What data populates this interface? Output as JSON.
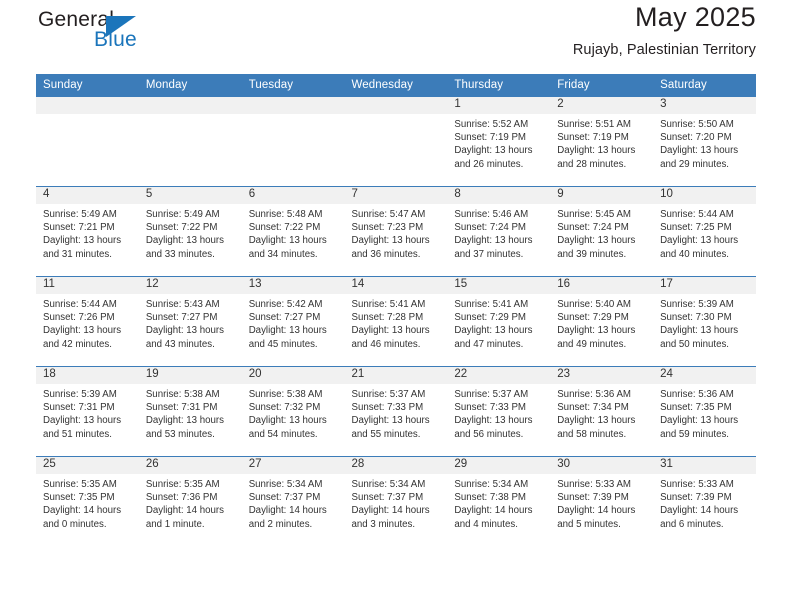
{
  "brand": {
    "name_top": "General",
    "name_bottom": "Blue",
    "accent_color": "#1b75bb"
  },
  "header": {
    "title": "May 2025",
    "subtitle": "Rujayb, Palestinian Territory"
  },
  "theme": {
    "header_row_bg": "#3c7cb9",
    "daynum_band_bg": "#f1f1f1",
    "text_color": "#333333"
  },
  "weekday_headers": [
    "Sunday",
    "Monday",
    "Tuesday",
    "Wednesday",
    "Thursday",
    "Friday",
    "Saturday"
  ],
  "calendar": {
    "weeks": [
      [
        {
          "day": "",
          "empty": true,
          "sunrise": "",
          "sunset": "",
          "daylight_line1": "",
          "daylight_line2": ""
        },
        {
          "day": "",
          "empty": true,
          "sunrise": "",
          "sunset": "",
          "daylight_line1": "",
          "daylight_line2": ""
        },
        {
          "day": "",
          "empty": true,
          "sunrise": "",
          "sunset": "",
          "daylight_line1": "",
          "daylight_line2": ""
        },
        {
          "day": "",
          "empty": true,
          "sunrise": "",
          "sunset": "",
          "daylight_line1": "",
          "daylight_line2": ""
        },
        {
          "day": "1",
          "empty": false,
          "sunrise": "Sunrise: 5:52 AM",
          "sunset": "Sunset: 7:19 PM",
          "daylight_line1": "Daylight: 13 hours",
          "daylight_line2": "and 26 minutes."
        },
        {
          "day": "2",
          "empty": false,
          "sunrise": "Sunrise: 5:51 AM",
          "sunset": "Sunset: 7:19 PM",
          "daylight_line1": "Daylight: 13 hours",
          "daylight_line2": "and 28 minutes."
        },
        {
          "day": "3",
          "empty": false,
          "sunrise": "Sunrise: 5:50 AM",
          "sunset": "Sunset: 7:20 PM",
          "daylight_line1": "Daylight: 13 hours",
          "daylight_line2": "and 29 minutes."
        }
      ],
      [
        {
          "day": "4",
          "empty": false,
          "sunrise": "Sunrise: 5:49 AM",
          "sunset": "Sunset: 7:21 PM",
          "daylight_line1": "Daylight: 13 hours",
          "daylight_line2": "and 31 minutes."
        },
        {
          "day": "5",
          "empty": false,
          "sunrise": "Sunrise: 5:49 AM",
          "sunset": "Sunset: 7:22 PM",
          "daylight_line1": "Daylight: 13 hours",
          "daylight_line2": "and 33 minutes."
        },
        {
          "day": "6",
          "empty": false,
          "sunrise": "Sunrise: 5:48 AM",
          "sunset": "Sunset: 7:22 PM",
          "daylight_line1": "Daylight: 13 hours",
          "daylight_line2": "and 34 minutes."
        },
        {
          "day": "7",
          "empty": false,
          "sunrise": "Sunrise: 5:47 AM",
          "sunset": "Sunset: 7:23 PM",
          "daylight_line1": "Daylight: 13 hours",
          "daylight_line2": "and 36 minutes."
        },
        {
          "day": "8",
          "empty": false,
          "sunrise": "Sunrise: 5:46 AM",
          "sunset": "Sunset: 7:24 PM",
          "daylight_line1": "Daylight: 13 hours",
          "daylight_line2": "and 37 minutes."
        },
        {
          "day": "9",
          "empty": false,
          "sunrise": "Sunrise: 5:45 AM",
          "sunset": "Sunset: 7:24 PM",
          "daylight_line1": "Daylight: 13 hours",
          "daylight_line2": "and 39 minutes."
        },
        {
          "day": "10",
          "empty": false,
          "sunrise": "Sunrise: 5:44 AM",
          "sunset": "Sunset: 7:25 PM",
          "daylight_line1": "Daylight: 13 hours",
          "daylight_line2": "and 40 minutes."
        }
      ],
      [
        {
          "day": "11",
          "empty": false,
          "sunrise": "Sunrise: 5:44 AM",
          "sunset": "Sunset: 7:26 PM",
          "daylight_line1": "Daylight: 13 hours",
          "daylight_line2": "and 42 minutes."
        },
        {
          "day": "12",
          "empty": false,
          "sunrise": "Sunrise: 5:43 AM",
          "sunset": "Sunset: 7:27 PM",
          "daylight_line1": "Daylight: 13 hours",
          "daylight_line2": "and 43 minutes."
        },
        {
          "day": "13",
          "empty": false,
          "sunrise": "Sunrise: 5:42 AM",
          "sunset": "Sunset: 7:27 PM",
          "daylight_line1": "Daylight: 13 hours",
          "daylight_line2": "and 45 minutes."
        },
        {
          "day": "14",
          "empty": false,
          "sunrise": "Sunrise: 5:41 AM",
          "sunset": "Sunset: 7:28 PM",
          "daylight_line1": "Daylight: 13 hours",
          "daylight_line2": "and 46 minutes."
        },
        {
          "day": "15",
          "empty": false,
          "sunrise": "Sunrise: 5:41 AM",
          "sunset": "Sunset: 7:29 PM",
          "daylight_line1": "Daylight: 13 hours",
          "daylight_line2": "and 47 minutes."
        },
        {
          "day": "16",
          "empty": false,
          "sunrise": "Sunrise: 5:40 AM",
          "sunset": "Sunset: 7:29 PM",
          "daylight_line1": "Daylight: 13 hours",
          "daylight_line2": "and 49 minutes."
        },
        {
          "day": "17",
          "empty": false,
          "sunrise": "Sunrise: 5:39 AM",
          "sunset": "Sunset: 7:30 PM",
          "daylight_line1": "Daylight: 13 hours",
          "daylight_line2": "and 50 minutes."
        }
      ],
      [
        {
          "day": "18",
          "empty": false,
          "sunrise": "Sunrise: 5:39 AM",
          "sunset": "Sunset: 7:31 PM",
          "daylight_line1": "Daylight: 13 hours",
          "daylight_line2": "and 51 minutes."
        },
        {
          "day": "19",
          "empty": false,
          "sunrise": "Sunrise: 5:38 AM",
          "sunset": "Sunset: 7:31 PM",
          "daylight_line1": "Daylight: 13 hours",
          "daylight_line2": "and 53 minutes."
        },
        {
          "day": "20",
          "empty": false,
          "sunrise": "Sunrise: 5:38 AM",
          "sunset": "Sunset: 7:32 PM",
          "daylight_line1": "Daylight: 13 hours",
          "daylight_line2": "and 54 minutes."
        },
        {
          "day": "21",
          "empty": false,
          "sunrise": "Sunrise: 5:37 AM",
          "sunset": "Sunset: 7:33 PM",
          "daylight_line1": "Daylight: 13 hours",
          "daylight_line2": "and 55 minutes."
        },
        {
          "day": "22",
          "empty": false,
          "sunrise": "Sunrise: 5:37 AM",
          "sunset": "Sunset: 7:33 PM",
          "daylight_line1": "Daylight: 13 hours",
          "daylight_line2": "and 56 minutes."
        },
        {
          "day": "23",
          "empty": false,
          "sunrise": "Sunrise: 5:36 AM",
          "sunset": "Sunset: 7:34 PM",
          "daylight_line1": "Daylight: 13 hours",
          "daylight_line2": "and 58 minutes."
        },
        {
          "day": "24",
          "empty": false,
          "sunrise": "Sunrise: 5:36 AM",
          "sunset": "Sunset: 7:35 PM",
          "daylight_line1": "Daylight: 13 hours",
          "daylight_line2": "and 59 minutes."
        }
      ],
      [
        {
          "day": "25",
          "empty": false,
          "sunrise": "Sunrise: 5:35 AM",
          "sunset": "Sunset: 7:35 PM",
          "daylight_line1": "Daylight: 14 hours",
          "daylight_line2": "and 0 minutes."
        },
        {
          "day": "26",
          "empty": false,
          "sunrise": "Sunrise: 5:35 AM",
          "sunset": "Sunset: 7:36 PM",
          "daylight_line1": "Daylight: 14 hours",
          "daylight_line2": "and 1 minute."
        },
        {
          "day": "27",
          "empty": false,
          "sunrise": "Sunrise: 5:34 AM",
          "sunset": "Sunset: 7:37 PM",
          "daylight_line1": "Daylight: 14 hours",
          "daylight_line2": "and 2 minutes."
        },
        {
          "day": "28",
          "empty": false,
          "sunrise": "Sunrise: 5:34 AM",
          "sunset": "Sunset: 7:37 PM",
          "daylight_line1": "Daylight: 14 hours",
          "daylight_line2": "and 3 minutes."
        },
        {
          "day": "29",
          "empty": false,
          "sunrise": "Sunrise: 5:34 AM",
          "sunset": "Sunset: 7:38 PM",
          "daylight_line1": "Daylight: 14 hours",
          "daylight_line2": "and 4 minutes."
        },
        {
          "day": "30",
          "empty": false,
          "sunrise": "Sunrise: 5:33 AM",
          "sunset": "Sunset: 7:39 PM",
          "daylight_line1": "Daylight: 14 hours",
          "daylight_line2": "and 5 minutes."
        },
        {
          "day": "31",
          "empty": false,
          "sunrise": "Sunrise: 5:33 AM",
          "sunset": "Sunset: 7:39 PM",
          "daylight_line1": "Daylight: 14 hours",
          "daylight_line2": "and 6 minutes."
        }
      ]
    ]
  }
}
